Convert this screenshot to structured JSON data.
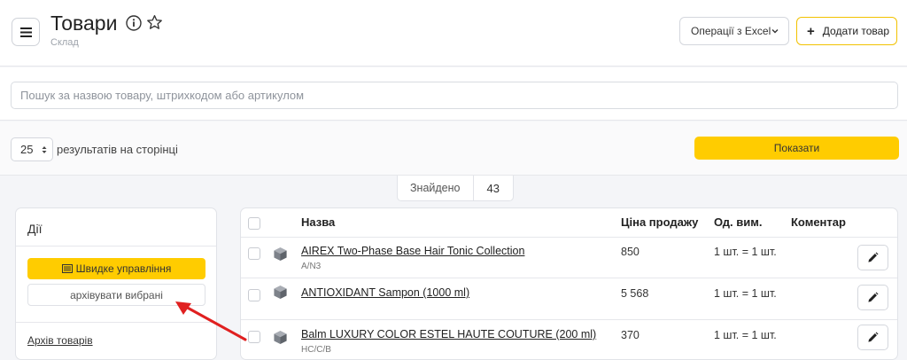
{
  "header": {
    "title": "Товари",
    "subtitle": "Склад",
    "excel_label": "Операції з Excel",
    "add_label": "Додати товар",
    "plus_symbol": "+"
  },
  "search": {
    "placeholder": "Пошук за назвою товару, штрихкодом або артикулом",
    "value": ""
  },
  "pager": {
    "per_page": "25",
    "per_page_label": "результатів на сторінці",
    "show_label": "Показати"
  },
  "found": {
    "label": "Знайдено",
    "count": "43"
  },
  "actions": {
    "title": "Дії",
    "quick_label": "Швидке управління",
    "archive_selected_label": "архівувати вибрані",
    "archive_link_label": "Архів товарів"
  },
  "table": {
    "columns": [
      "Назва",
      "Ціна продажу",
      "Од. вим.",
      "Коментар"
    ],
    "rows": [
      {
        "name": "AIREX Two-Phase Base Hair Tonic Collection",
        "sku": "A/N3",
        "price": "850",
        "unit": "1 шт. = 1 шт.",
        "comment": ""
      },
      {
        "name": "ANTIOXIDANT Sampon (1000 ml)",
        "sku": "",
        "price": "5 568",
        "unit": "1 шт. = 1 шт.",
        "comment": ""
      },
      {
        "name": "Balm LUXURY COLOR ESTEL HAUTE COUTURE (200 ml)",
        "sku": "HC/C/B",
        "price": "370",
        "unit": "1 шт. = 1 шт.",
        "comment": ""
      }
    ]
  },
  "colors": {
    "accent": "#ffcc00",
    "annotation_arrow": "#e02020"
  }
}
